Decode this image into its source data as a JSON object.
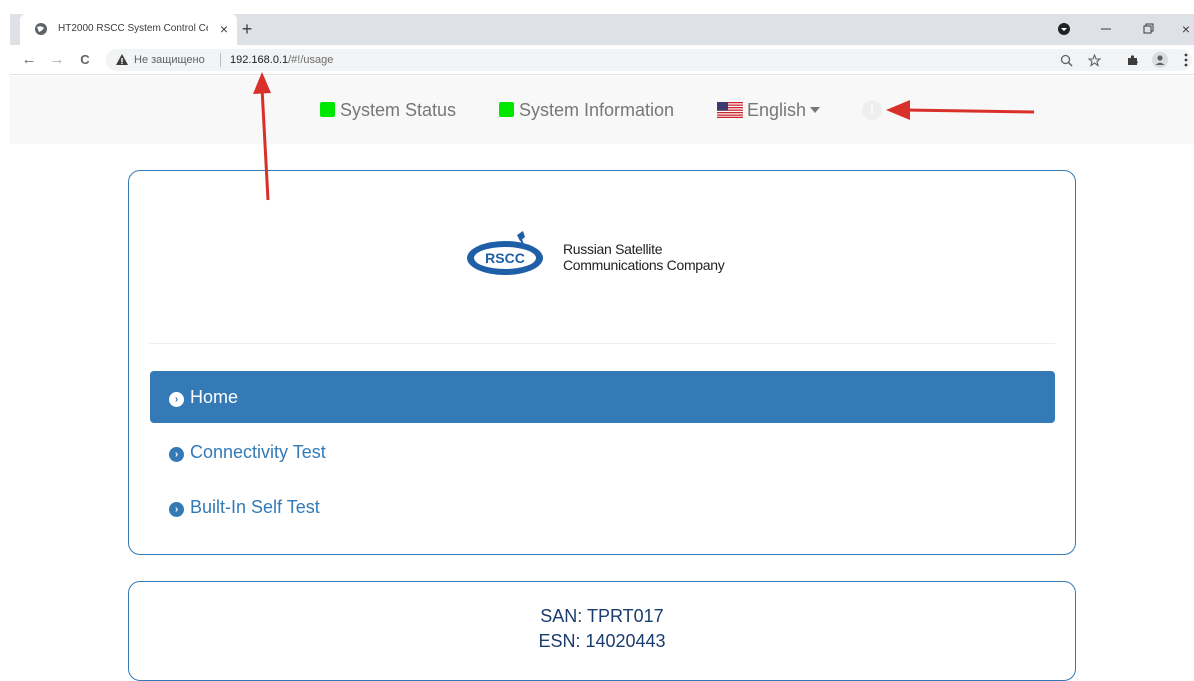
{
  "browser": {
    "tab_title": "HT2000 RSCC System Control Ce",
    "close_glyph": "×",
    "new_tab_glyph": "+",
    "insecure_label": "Не защищено",
    "url_host": "192.168.0.1",
    "url_path": "/#!/usage",
    "back_glyph": "←",
    "forward_glyph": "→",
    "reload_glyph": "C"
  },
  "topnav": {
    "system_status": "System Status",
    "system_information": "System Information",
    "language": "English",
    "status_color": "#00e800"
  },
  "logo": {
    "line1": "Russian Satellite",
    "line2": "Communications Company",
    "badge": "RSCC"
  },
  "menu": {
    "items": [
      {
        "label": "Home",
        "active": true
      },
      {
        "label": "Connectivity Test",
        "active": false
      },
      {
        "label": "Built-In Self Test",
        "active": false
      }
    ]
  },
  "device": {
    "san": "SAN: TPRT017",
    "esn": "ESN: 14020443"
  },
  "colors": {
    "accent": "#337ab7",
    "annotation_arrow": "#d9302a"
  }
}
